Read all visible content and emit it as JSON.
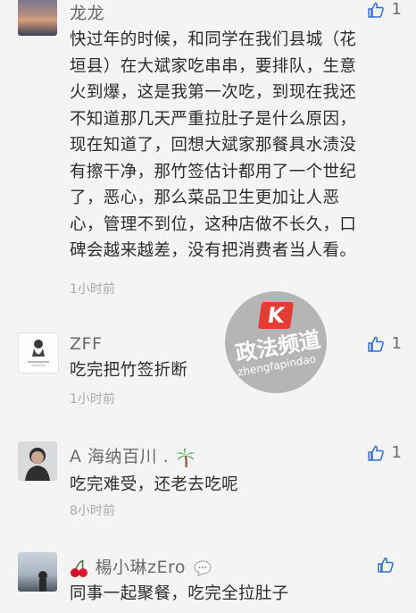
{
  "comments": [
    {
      "name": "龙龙",
      "likes": "1",
      "lines": [
        "快过年的时候，和同学在我们县城（花",
        "垣县）在大斌家吃串串，要排队，生意",
        "火到爆，这是我第一次吃，到现在我还",
        "不知道那几天严重拉肚子是什么原因，",
        "现在知道了，回想大斌家那餐具水渍没",
        "有擦干净，那竹签估计都用了一个世纪",
        "了，恶心，那么菜品卫生更加让人恶",
        "心，管理不到位，这种店做不长久，口",
        "碑会越来越差，没有把消费者当人看。"
      ],
      "time": "1小时前"
    },
    {
      "name": "ZFF",
      "likes": "1",
      "text": "吃完把竹签折断",
      "time": "1小时前"
    },
    {
      "name": "A 海纳百川 .",
      "likes": "1",
      "text": "吃完难受，还老去吃呢",
      "time": "8小时前"
    },
    {
      "name": "楊小琳zEro",
      "likes": "",
      "text": "同事一起聚餐，吃完全拉肚子",
      "time": ""
    }
  ],
  "watermark": {
    "logo": "K",
    "title": "政法频道",
    "subtitle": "zhengfapindao"
  },
  "icons": {
    "like": "thumbs-up-icon",
    "palm": "palm-tree-emoji",
    "cherry": "cherry-emoji",
    "bubble": "speech-bubble-icon"
  },
  "colors": {
    "background": "#f4f4f4",
    "text": "#2d2d2d",
    "name": "#6a6a6a",
    "time": "#a9a9a9",
    "watermark_red": "#e43c32"
  }
}
